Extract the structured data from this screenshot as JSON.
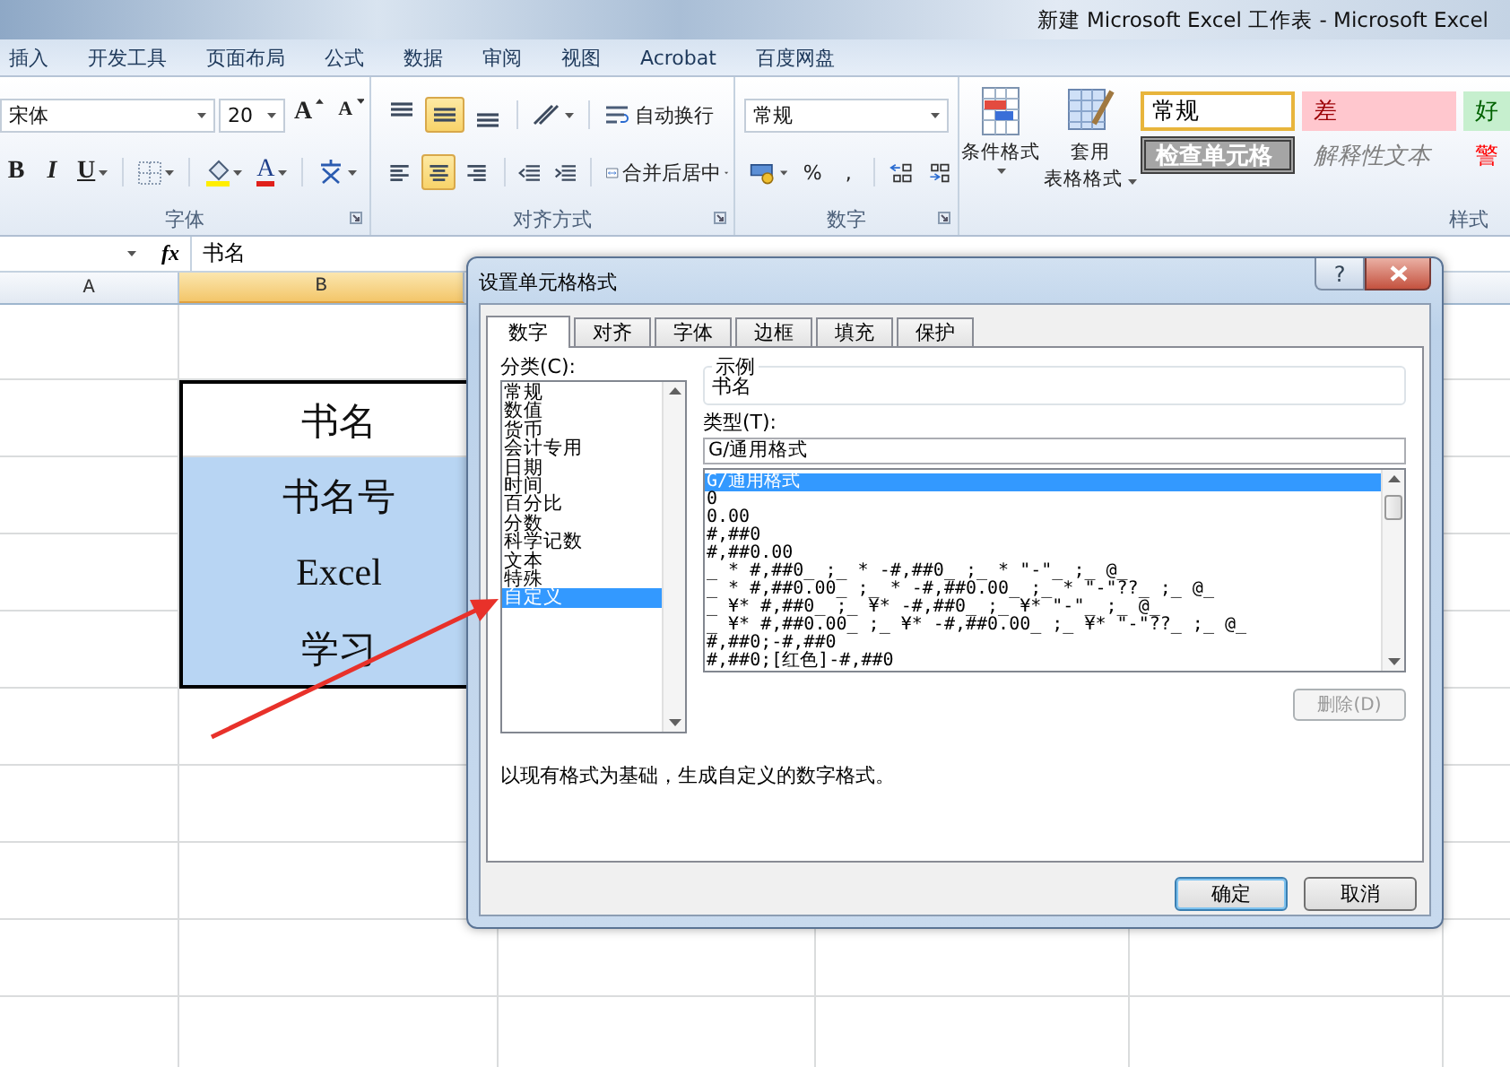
{
  "window": {
    "title": "新建 Microsoft Excel 工作表 - Microsoft Excel"
  },
  "ribbon_tabs": [
    "插入",
    "开发工具",
    "页面布局",
    "公式",
    "数据",
    "审阅",
    "视图",
    "Acrobat",
    "百度网盘"
  ],
  "ribbon": {
    "font": {
      "name": "宋体",
      "size": "20",
      "grow": "A",
      "shrink": "A",
      "bold": "B",
      "italic": "I",
      "underline": "U",
      "font_color": "A",
      "label": "字体"
    },
    "alignment": {
      "vertical": [
        {
          "kind": "top",
          "selected": false
        },
        {
          "kind": "middle",
          "selected": true
        },
        {
          "kind": "bottom",
          "selected": false
        }
      ],
      "horizontal": [
        {
          "kind": "left",
          "selected": false
        },
        {
          "kind": "center",
          "selected": true
        },
        {
          "kind": "right",
          "selected": false
        }
      ],
      "wrap": "自动换行",
      "merge": "合并后居中",
      "label": "对齐方式"
    },
    "number": {
      "format": "常规",
      "percent": "%",
      "comma": ",",
      "label": "数字"
    },
    "styles": {
      "conditional": "条件格式",
      "table_format_1": "套用",
      "table_format_2": "表格格式",
      "label": "样式",
      "gallery": [
        {
          "label": "常规",
          "kind": "normal",
          "selected": true
        },
        {
          "label": "差",
          "kind": "bad",
          "selected": false
        },
        {
          "label": "好",
          "kind": "good",
          "selected": false
        },
        {
          "label": "检查单元格",
          "kind": "check",
          "selected": false
        },
        {
          "label": "解释性文本",
          "kind": "explanatory",
          "selected": false
        },
        {
          "label": "警",
          "kind": "warning",
          "selected": false
        }
      ]
    }
  },
  "formula_bar": {
    "fx": "fx",
    "content": "书名"
  },
  "sheet": {
    "columns": [
      {
        "label": "A",
        "selected": false
      },
      {
        "label": "B",
        "selected": true
      }
    ],
    "b_column": [
      {
        "text": "书名",
        "selected": false
      },
      {
        "text": "书名号",
        "selected": true
      },
      {
        "text": "Excel",
        "selected": true
      },
      {
        "text": "学习",
        "selected": true
      }
    ]
  },
  "dialog": {
    "title": "设置单元格格式",
    "help": "?",
    "tabs": [
      {
        "label": "数字",
        "selected": true
      },
      {
        "label": "对齐",
        "selected": false
      },
      {
        "label": "字体",
        "selected": false
      },
      {
        "label": "边框",
        "selected": false
      },
      {
        "label": "填充",
        "selected": false
      },
      {
        "label": "保护",
        "selected": false
      }
    ],
    "category_label": "分类(C):",
    "categories": [
      {
        "label": "常规",
        "selected": false
      },
      {
        "label": "数值",
        "selected": false
      },
      {
        "label": "货币",
        "selected": false
      },
      {
        "label": "会计专用",
        "selected": false
      },
      {
        "label": "日期",
        "selected": false
      },
      {
        "label": "时间",
        "selected": false
      },
      {
        "label": "百分比",
        "selected": false
      },
      {
        "label": "分数",
        "selected": false
      },
      {
        "label": "科学记数",
        "selected": false
      },
      {
        "label": "文本",
        "selected": false
      },
      {
        "label": "特殊",
        "selected": false
      },
      {
        "label": "自定义",
        "selected": true
      }
    ],
    "sample_label": "示例",
    "sample_value": "书名",
    "type_label": "类型(T):",
    "type_value": "G/通用格式",
    "types": [
      {
        "label": "G/通用格式",
        "selected": true
      },
      {
        "label": "0",
        "selected": false
      },
      {
        "label": "0.00",
        "selected": false
      },
      {
        "label": "#,##0",
        "selected": false
      },
      {
        "label": "#,##0.00",
        "selected": false
      },
      {
        "label": "_ * #,##0_ ;_ * -#,##0_ ;_ * \"-\"_ ;_ @_",
        "selected": false
      },
      {
        "label": "_ * #,##0.00_ ;_ * -#,##0.00_ ;_ * \"-\"??_ ;_ @_",
        "selected": false
      },
      {
        "label": "_ ¥* #,##0_ ;_ ¥* -#,##0_ ;_ ¥* \"-\"_ ;_ @_",
        "selected": false
      },
      {
        "label": "_ ¥* #,##0.00_ ;_ ¥* -#,##0.00_ ;_ ¥* \"-\"??_ ;_ @_",
        "selected": false
      },
      {
        "label": "#,##0;-#,##0",
        "selected": false
      },
      {
        "label": "#,##0;[红色]-#,##0",
        "selected": false
      }
    ],
    "delete_button": {
      "label": "删除(D)",
      "disabled": true
    },
    "description": "以现有格式为基础，生成自定义的数字格式。",
    "buttons": [
      {
        "label": "确定",
        "kind": "default"
      },
      {
        "label": "取消",
        "kind": "normal"
      }
    ]
  }
}
